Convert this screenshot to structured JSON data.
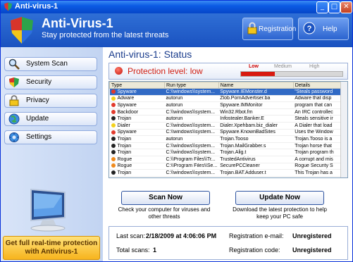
{
  "window": {
    "title": "Anti-virus-1"
  },
  "header": {
    "app_title": "Anti-Virus-1",
    "subtitle": "Stay protected from the latest threats",
    "registration_label": "Registration",
    "help_label": "Help"
  },
  "sidebar": {
    "items": [
      {
        "label": "System Scan",
        "icon": "magnifier-icon"
      },
      {
        "label": "Security",
        "icon": "shield-icon"
      },
      {
        "label": "Privacy",
        "icon": "lock-icon"
      },
      {
        "label": "Update",
        "icon": "globe-icon"
      },
      {
        "label": "Settings",
        "icon": "gear-icon"
      }
    ],
    "promo_line1": "Get full real-time protection",
    "promo_line2": "with Antivirus-1"
  },
  "status": {
    "title": "Anti-virus-1: Status",
    "protection_text": "Protection level: low",
    "level_labels": {
      "low": "Low",
      "medium": "Medium",
      "high": "High"
    },
    "level_fraction": 0.33
  },
  "threats": {
    "columns": [
      "Type",
      "Run type",
      "Name",
      "Details"
    ],
    "rows": [
      {
        "type": "Spyware",
        "run": "C:\\\\windows\\\\system...",
        "name": "Spyware.IEMonster.d",
        "details": "\"Steals password",
        "color": "#e23a2c"
      },
      {
        "type": "Adware",
        "run": "autorun",
        "name": "Zlob.PornAdvertiser.ba",
        "details": "Adware that disp",
        "color": "#f3d11b"
      },
      {
        "type": "Spyware",
        "run": "autorun",
        "name": "Spyware.IMMonitor",
        "details": "program that can",
        "color": "#e23a2c"
      },
      {
        "type": "Backdoor",
        "run": "C:\\\\windows\\\\system...",
        "name": "Win32.Rbot.fm",
        "details": "An IRC controllec",
        "color": "#e23a2c"
      },
      {
        "type": "Trojan",
        "run": "autorun",
        "name": "Infostealer.Banker.E",
        "details": "Steals sensitive ir",
        "color": "#222222"
      },
      {
        "type": "Dialer",
        "run": "C:\\\\windows\\\\system...",
        "name": "Dialer.Xpehbam.biz_dialer",
        "details": "A Dialer that load",
        "color": "#f3d11b"
      },
      {
        "type": "Spyware",
        "run": "C:\\\\windows\\\\system...",
        "name": "Spyware.KnownBadSites",
        "details": "Uses the Window",
        "color": "#e23a2c"
      },
      {
        "type": "Trojan",
        "run": "autorun",
        "name": "Trojan.Tooso",
        "details": "Trojan.Tooso is a",
        "color": "#222222"
      },
      {
        "type": "Trojan",
        "run": "C:\\\\windows\\\\system...",
        "name": "Trojan.MailGrabber.s",
        "details": "Trojan horse that",
        "color": "#222222"
      },
      {
        "type": "Trojan",
        "run": "C:\\\\windows\\\\system...",
        "name": "Trojan.Alig.t",
        "details": "Trojan program th",
        "color": "#222222"
      },
      {
        "type": "Rogue",
        "run": "C:\\\\Program Files\\\\Tr...",
        "name": "TrustedAntivirus",
        "details": "A corrupt and mis",
        "color": "#f08a1c"
      },
      {
        "type": "Rogue",
        "run": "C:\\\\Program Files\\\\Se...",
        "name": "SecurePCCleaner",
        "details": "Rogue Security S",
        "color": "#f08a1c"
      },
      {
        "type": "Trojan",
        "run": "C:\\\\windows\\\\system...",
        "name": "Trojan.BAT.Adduser.t",
        "details": "This Trojan has a",
        "color": "#222222"
      }
    ]
  },
  "actions": {
    "scan_label": "Scan Now",
    "scan_desc": "Check your computer for viruses and other threats",
    "update_label": "Update Now",
    "update_desc": "Download the latest protection to help keep your PC safe"
  },
  "info": {
    "last_scan_label": "Last scan:",
    "last_scan_value": "2/18/2009 at 4:06:06 PM",
    "total_scans_label": "Total scans:",
    "total_scans_value": "1",
    "reg_email_label": "Registration e-mail:",
    "reg_email_value": "Unregistered",
    "reg_code_label": "Registration code:",
    "reg_code_value": "Unregistered"
  },
  "colors": {
    "accent": "#1a52c0",
    "danger": "#d01f12",
    "promo": "#f7b41d"
  }
}
